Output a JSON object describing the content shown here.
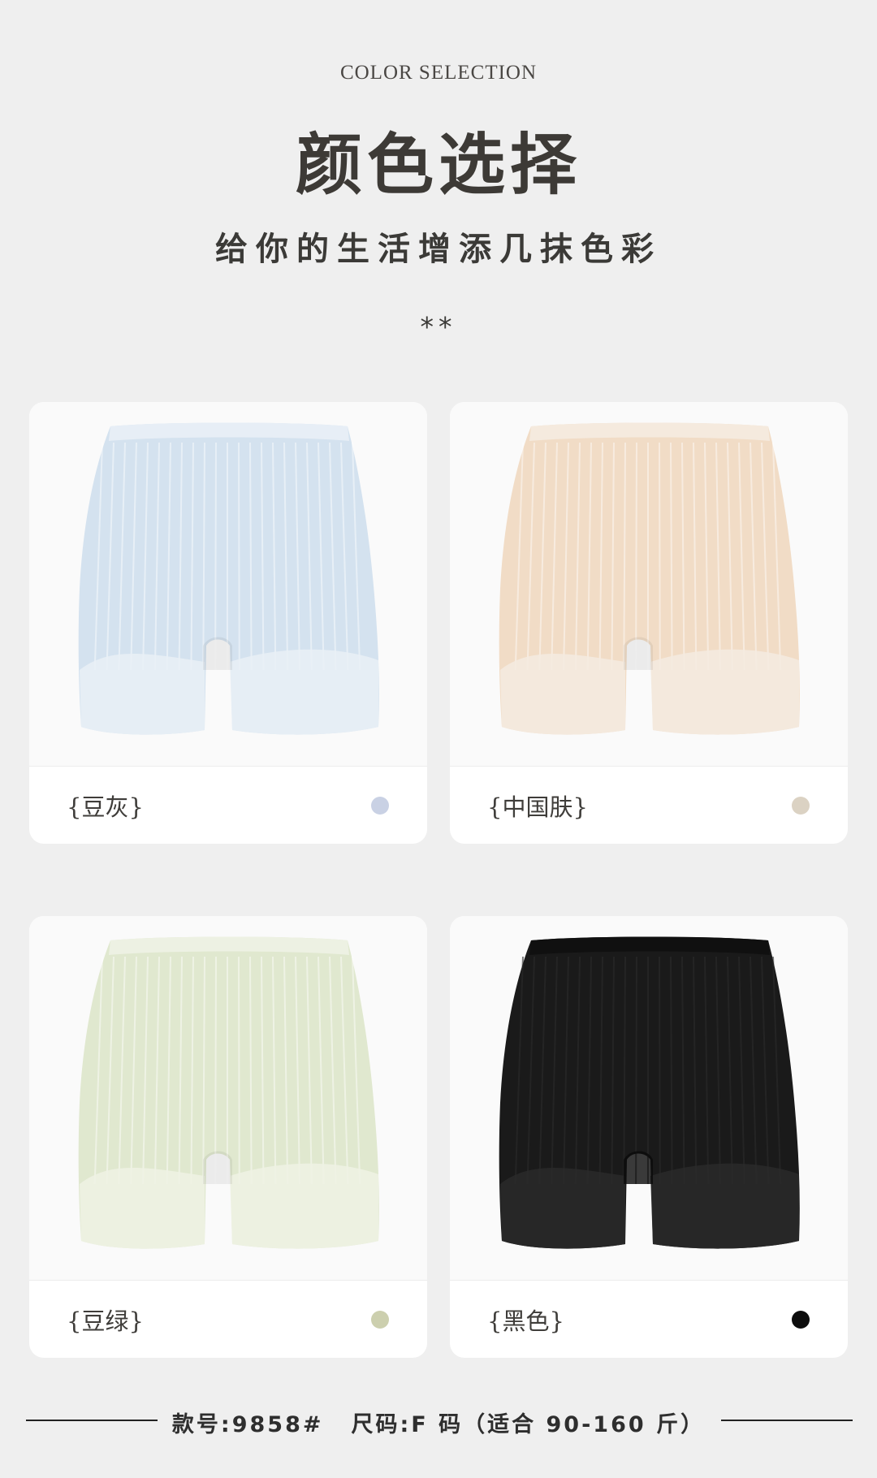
{
  "header": {
    "eyebrow": "COLOR SELECTION",
    "title": "颜色选择",
    "subtitle": "给你的生活增添几抹色彩",
    "ornament": "**"
  },
  "products": [
    {
      "label": "{豆灰}",
      "swatch_color": "#c9d1e4",
      "garment_color": "#d4e2ef",
      "lace_color": "#e9f0f6"
    },
    {
      "label": "{中国肤}",
      "swatch_color": "#dbd2c3",
      "garment_color": "#f1dcc6",
      "lace_color": "#f5ebe0"
    },
    {
      "label": "{豆绿}",
      "swatch_color": "#cccfae",
      "garment_color": "#e0e8cf",
      "lace_color": "#eef2e4"
    },
    {
      "label": "{黑色}",
      "swatch_color": "#0d0d0d",
      "garment_color": "#1a1a1a",
      "lace_color": "#2a2a2a"
    }
  ],
  "footer": {
    "style_no": "款号:9858#",
    "size": "尺码:F 码（适合 90-160 斤）"
  }
}
